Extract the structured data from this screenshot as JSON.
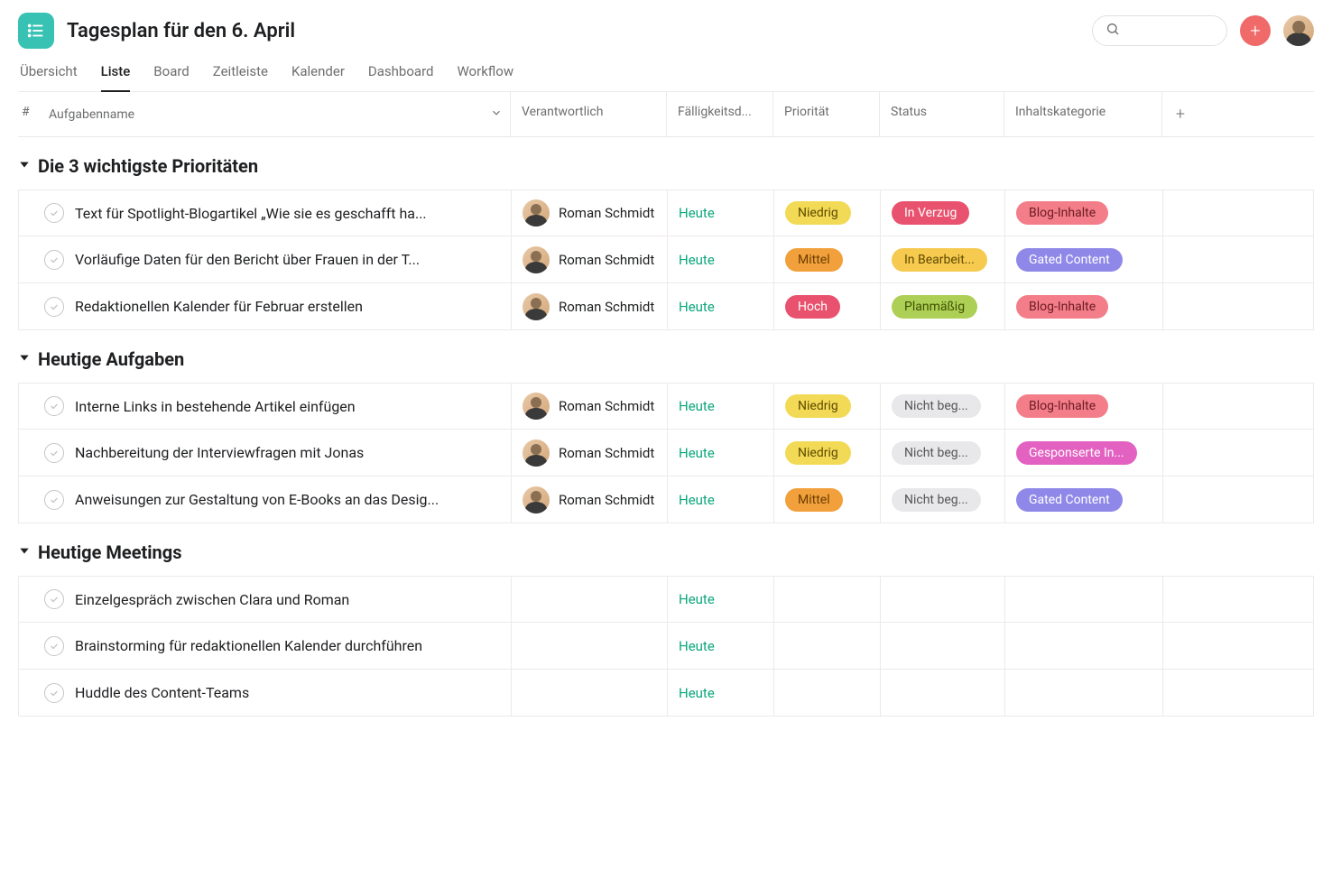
{
  "header": {
    "title": "Tagesplan für den 6. April",
    "search_placeholder": ""
  },
  "tabs": [
    {
      "label": "Übersicht",
      "active": false
    },
    {
      "label": "Liste",
      "active": true
    },
    {
      "label": "Board",
      "active": false
    },
    {
      "label": "Zeitleiste",
      "active": false
    },
    {
      "label": "Kalender",
      "active": false
    },
    {
      "label": "Dashboard",
      "active": false
    },
    {
      "label": "Workflow",
      "active": false
    }
  ],
  "columns": {
    "num": "#",
    "name": "Aufgabenname",
    "assignee": "Verantwortlich",
    "due": "Fälligkeitsd...",
    "priority": "Priorität",
    "status": "Status",
    "category": "Inhaltskategorie"
  },
  "sections": [
    {
      "title": "Die 3 wichtigste Prioritäten",
      "rows": [
        {
          "name": "Text für Spotlight-Blogartikel „Wie sie es geschafft ha...",
          "assignee": "Roman Schmidt",
          "due": "Heute",
          "priority": {
            "label": "Niedrig",
            "class": "pill-yellow"
          },
          "status": {
            "label": "In Verzug",
            "class": "pill-redsolid"
          },
          "category": {
            "label": "Blog-Inhalte",
            "class": "pill-pinkred"
          }
        },
        {
          "name": "Vorläufige Daten für den Bericht über Frauen in der T...",
          "assignee": "Roman Schmidt",
          "due": "Heute",
          "priority": {
            "label": "Mittel",
            "class": "pill-orange"
          },
          "status": {
            "label": "In Bearbeit...",
            "class": "pill-amber"
          },
          "category": {
            "label": "Gated Content",
            "class": "pill-purple"
          }
        },
        {
          "name": "Redaktionellen Kalender für Februar erstellen",
          "assignee": "Roman Schmidt",
          "due": "Heute",
          "priority": {
            "label": "Hoch",
            "class": "pill-red"
          },
          "status": {
            "label": "Planmäßig",
            "class": "pill-green"
          },
          "category": {
            "label": "Blog-Inhalte",
            "class": "pill-pinkred"
          }
        }
      ]
    },
    {
      "title": "Heutige Aufgaben",
      "rows": [
        {
          "name": "Interne Links in bestehende Artikel einfügen",
          "assignee": "Roman Schmidt",
          "due": "Heute",
          "priority": {
            "label": "Niedrig",
            "class": "pill-yellow"
          },
          "status": {
            "label": "Nicht beg...",
            "class": "pill-gray"
          },
          "category": {
            "label": "Blog-Inhalte",
            "class": "pill-pinkred"
          }
        },
        {
          "name": "Nachbereitung der Interviewfragen mit Jonas",
          "assignee": "Roman Schmidt",
          "due": "Heute",
          "priority": {
            "label": "Niedrig",
            "class": "pill-yellow"
          },
          "status": {
            "label": "Nicht beg...",
            "class": "pill-gray"
          },
          "category": {
            "label": "Gesponserte In...",
            "class": "pill-magenta"
          }
        },
        {
          "name": "Anweisungen zur Gestaltung von E-Books an das Desig...",
          "assignee": "Roman Schmidt",
          "due": "Heute",
          "priority": {
            "label": "Mittel",
            "class": "pill-orange"
          },
          "status": {
            "label": "Nicht beg...",
            "class": "pill-gray"
          },
          "category": {
            "label": "Gated Content",
            "class": "pill-purple"
          }
        }
      ]
    },
    {
      "title": "Heutige Meetings",
      "rows": [
        {
          "name": "Einzelgespräch zwischen Clara und Roman",
          "assignee": null,
          "due": "Heute",
          "priority": null,
          "status": null,
          "category": null
        },
        {
          "name": "Brainstorming für redaktionellen Kalender durchführen",
          "assignee": null,
          "due": "Heute",
          "priority": null,
          "status": null,
          "category": null
        },
        {
          "name": "Huddle des Content-Teams",
          "assignee": null,
          "due": "Heute",
          "priority": null,
          "status": null,
          "category": null
        }
      ]
    }
  ]
}
